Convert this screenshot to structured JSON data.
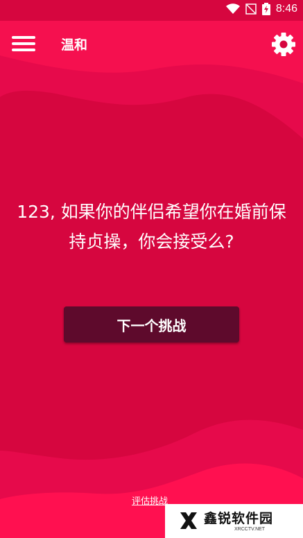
{
  "status": {
    "time": "8:46"
  },
  "header": {
    "title": "温和"
  },
  "question": {
    "text": "123, 如果你的伴侣希望你在婚前保持贞操，你会接受么?"
  },
  "next_button": {
    "label": "下一个挑战"
  },
  "rate_link": {
    "label": "评估挑战"
  },
  "watermark": {
    "title": "鑫锐软件园",
    "subtitle": "XRCCTV.NET"
  },
  "colors": {
    "background": "#d6063f",
    "accent_wave": "#ff1050",
    "button": "#5e0a2c"
  }
}
